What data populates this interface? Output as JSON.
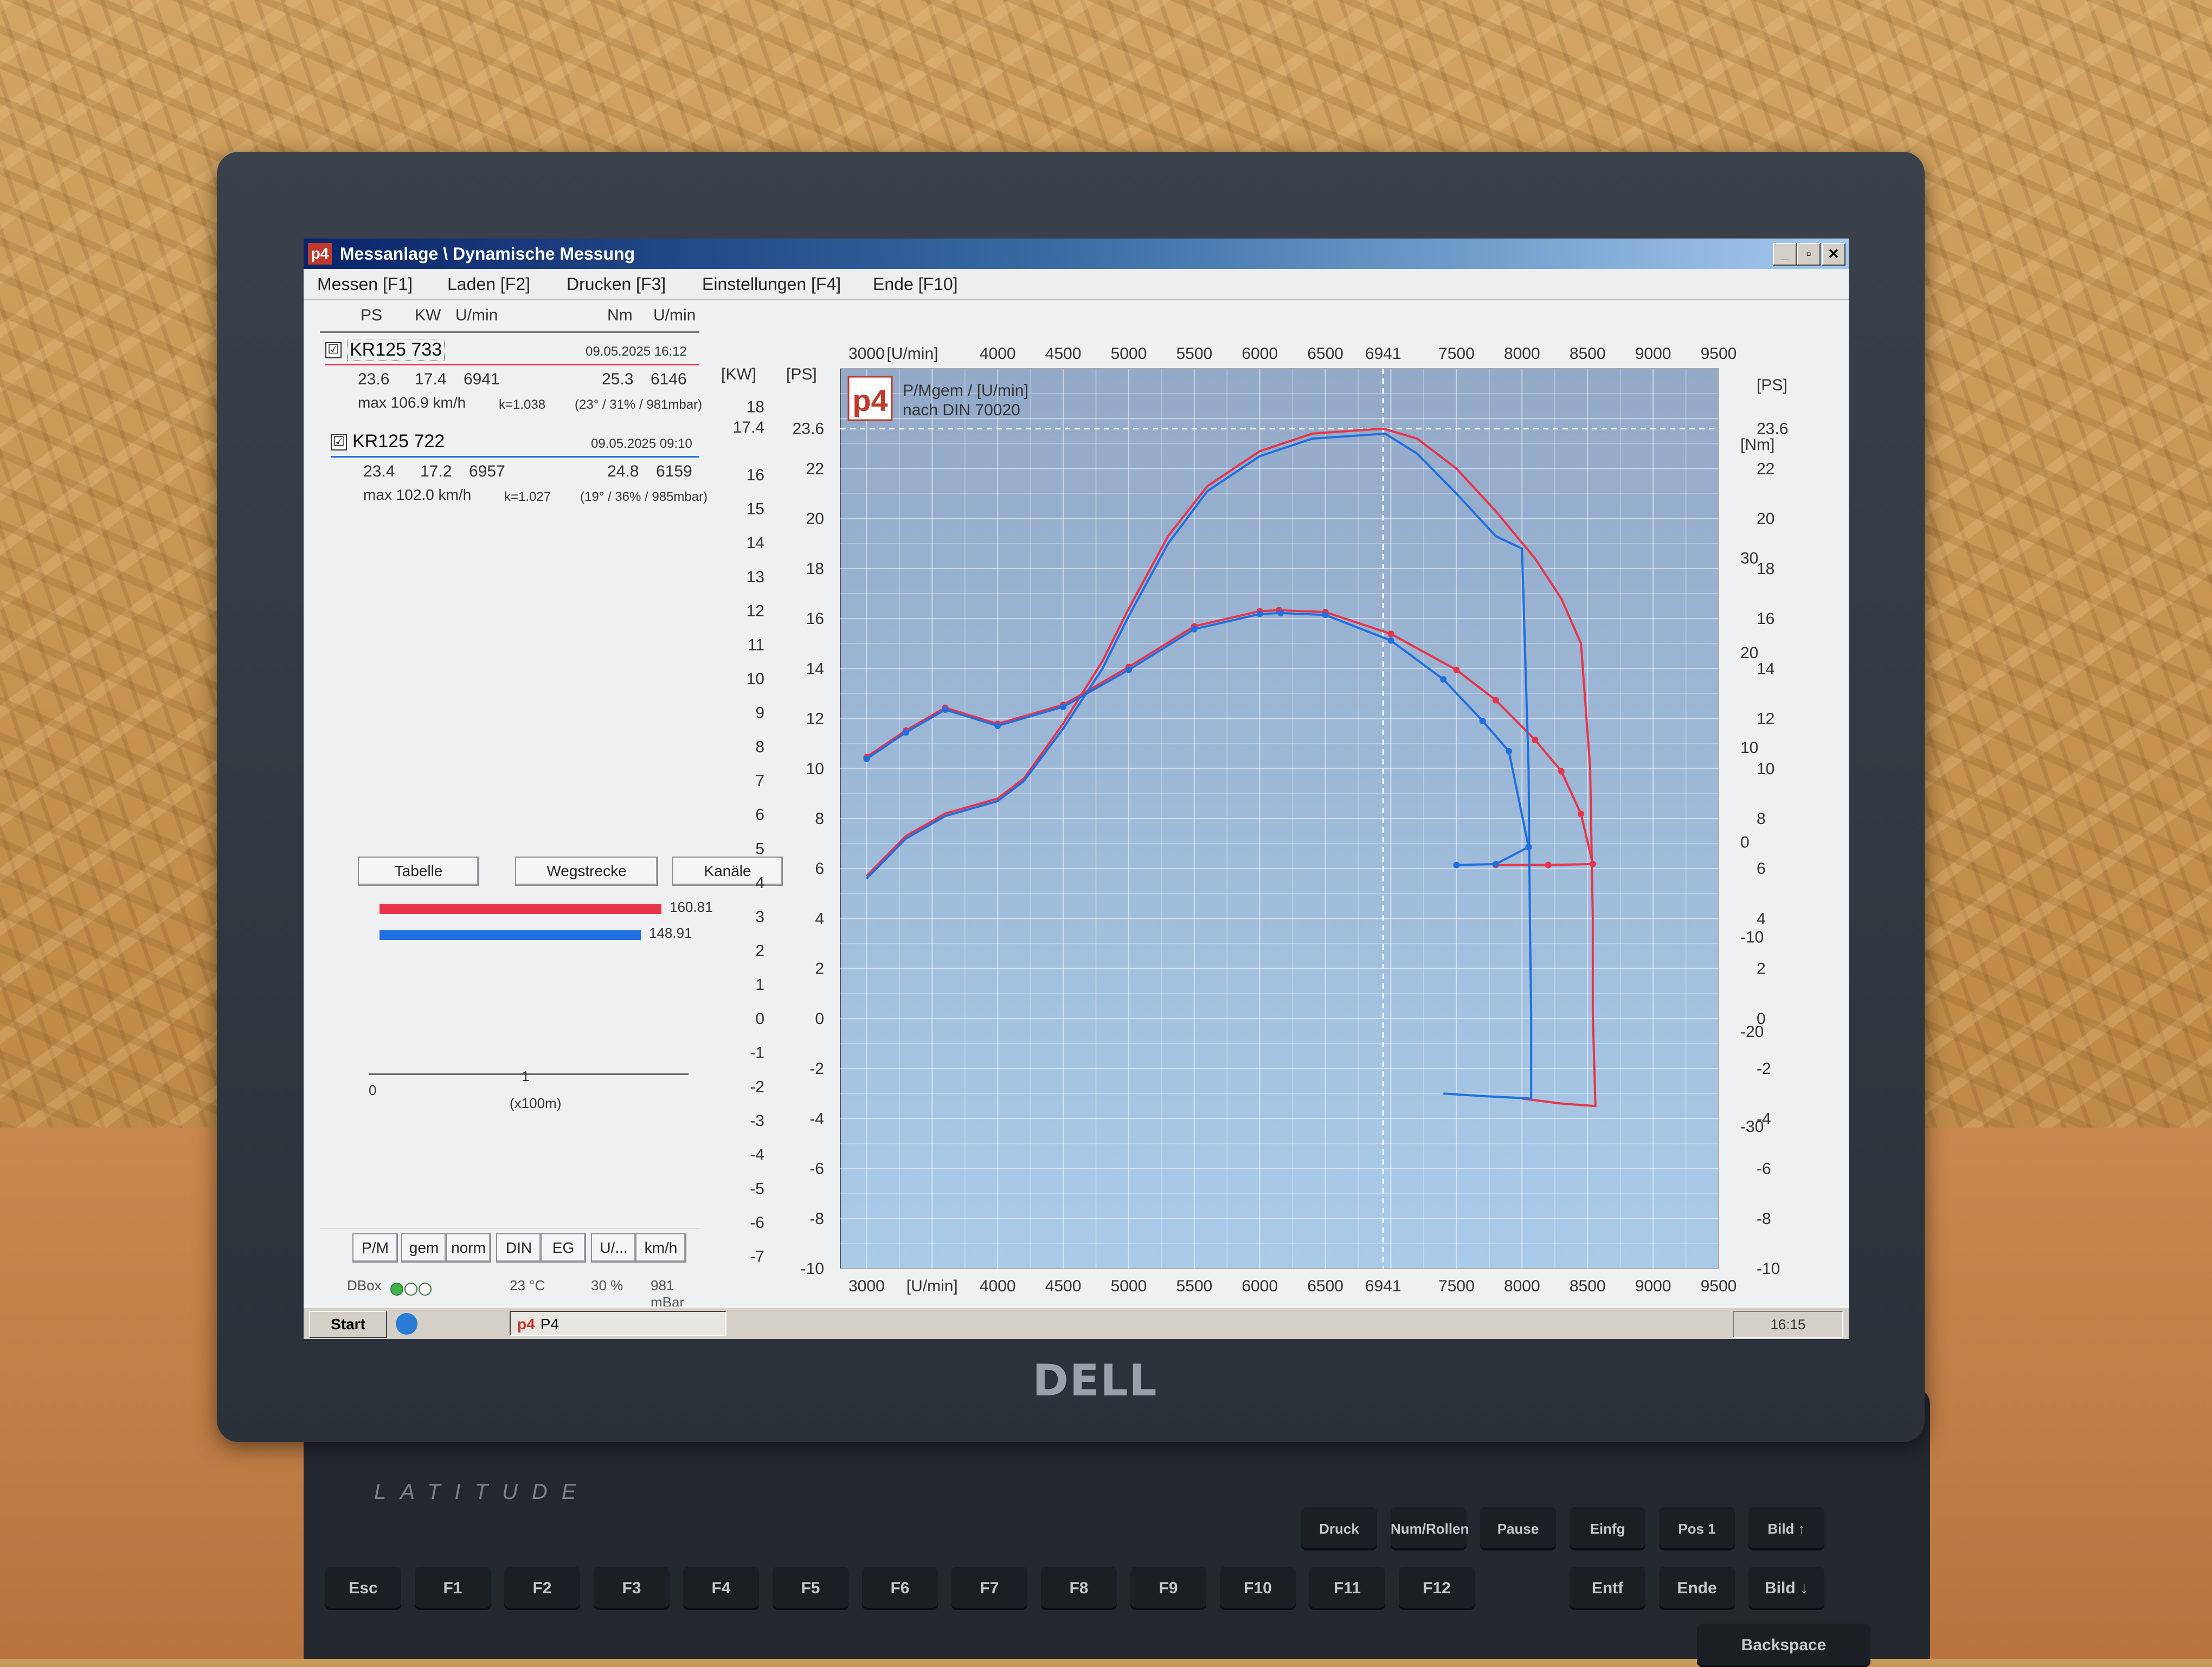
{
  "window": {
    "title": "Messanlage \\ Dynamische Messung",
    "app_icon": "p4"
  },
  "menu": [
    {
      "label": "Messen [F1]"
    },
    {
      "label": "Laden [F2]"
    },
    {
      "label": "Drucken [F3]"
    },
    {
      "label": "Einstellungen [F4]"
    },
    {
      "label": "Ende [F10]"
    }
  ],
  "panel": {
    "headers": {
      "ps": "PS",
      "kw": "KW",
      "rpm1": "U/min",
      "nm": "Nm",
      "rpm2": "U/min"
    },
    "entries": [
      {
        "checked": "☑",
        "name": "KR125 733",
        "date": "09.05.2025 16:12",
        "ps": "23.6",
        "kw": "17.4",
        "rpm": "6941",
        "nm": "25.3",
        "nm_rpm": "6146",
        "max": "max 106.9 km/h",
        "k": "k=1.038",
        "env": "(23° / 31% / 981mbar)",
        "color": "#e8344a"
      },
      {
        "checked": "☑",
        "name": "KR125 722",
        "date": "09.05.2025 09:10",
        "ps": "23.4",
        "kw": "17.2",
        "rpm": "6957",
        "nm": "24.8",
        "nm_rpm": "6159",
        "max": "max 102.0 km/h",
        "k": "k=1.027",
        "env": "(19° / 36% / 985mbar)",
        "color": "#1f6fe0"
      }
    ],
    "buttons_row1": [
      "P/M",
      "gem",
      "norm",
      "DIN",
      "EG",
      "U/...",
      "km/h"
    ],
    "buttons_row2": [
      "Tabelle",
      "Wegstrecke",
      "Kanäle"
    ],
    "bars": [
      {
        "value": "160.81",
        "color": "#e8344a"
      },
      {
        "value": "148.91",
        "color": "#1f6fe0"
      }
    ],
    "scale": {
      "zero": "0",
      "one": "1",
      "unit": "(x100m)"
    },
    "status": {
      "dbox": "DBox",
      "temp": "23 °C",
      "humidity": "30 %",
      "pressure": "981 mBar"
    }
  },
  "taskbar": {
    "start": "Start",
    "task": "P4",
    "clock": "16:15"
  },
  "laptop": {
    "brand": "DELL",
    "model": "LATITUDE",
    "keys": [
      "Esc",
      "F1",
      "F2",
      "F3",
      "F4",
      "F5",
      "F6",
      "F7",
      "F8",
      "F9",
      "F10",
      "F11",
      "F12",
      "Druck",
      "Num/Rollen",
      "Pause",
      "Einfg",
      "Pos 1",
      "Bild ↑",
      "Entf",
      "Ende",
      "Bild ↓",
      "Backspace"
    ]
  },
  "chart_data": {
    "type": "line",
    "title": "P/Mgem / [U/min]",
    "subtitle": "nach DIN 70020",
    "logo": "p4",
    "x_axis": {
      "label": "[U/min]",
      "ticks": [
        3000,
        4000,
        4500,
        5000,
        5500,
        6000,
        6500,
        6941,
        7500,
        8000,
        8500,
        9000,
        9500
      ],
      "range": [
        2800,
        9500
      ]
    },
    "y_axis_kw": {
      "label": "[KW]",
      "ticks": [
        -7,
        -6,
        -5,
        -4,
        -3,
        -2,
        -1,
        0,
        1,
        2,
        3,
        4,
        5,
        6,
        7,
        8,
        9,
        10,
        11,
        12,
        13,
        14,
        15,
        16,
        17.4,
        18
      ]
    },
    "y_axis_ps": {
      "label": "[PS]",
      "ticks": [
        -10,
        -8,
        -6,
        -4,
        -2,
        0,
        2,
        4,
        6,
        8,
        10,
        12,
        14,
        16,
        18,
        20,
        22,
        23.6
      ],
      "range": [
        -10,
        26
      ]
    },
    "y_axis_nm": {
      "label": "[Nm]",
      "ticks": [
        -30,
        -20,
        -10,
        0,
        10,
        20,
        30
      ],
      "range": [
        -45,
        50
      ]
    },
    "highlight": {
      "x": 6941,
      "y_ps": 23.6
    },
    "series": [
      {
        "name": "KR125 733",
        "color": "#e8344a",
        "power_ps": [
          [
            3000,
            5.7
          ],
          [
            3300,
            7.3
          ],
          [
            3600,
            8.2
          ],
          [
            4000,
            8.8
          ],
          [
            4200,
            9.6
          ],
          [
            4500,
            11.8
          ],
          [
            4800,
            14.3
          ],
          [
            5000,
            16.4
          ],
          [
            5300,
            19.3
          ],
          [
            5600,
            21.3
          ],
          [
            6000,
            22.7
          ],
          [
            6400,
            23.4
          ],
          [
            6941,
            23.6
          ],
          [
            7200,
            23.2
          ],
          [
            7500,
            22.0
          ],
          [
            7800,
            20.3
          ],
          [
            8100,
            18.4
          ],
          [
            8300,
            16.8
          ],
          [
            8450,
            15.0
          ],
          [
            8520,
            10.0
          ],
          [
            8540,
            4.0
          ],
          [
            8540,
            0.2
          ],
          [
            8560,
            -3.5
          ],
          [
            8300,
            -3.4
          ],
          [
            8000,
            -3.2
          ]
        ],
        "torque_nm": [
          [
            3000,
            9.0
          ],
          [
            3300,
            11.8
          ],
          [
            3600,
            14.2
          ],
          [
            4000,
            12.5
          ],
          [
            4500,
            14.5
          ],
          [
            5000,
            18.5
          ],
          [
            5500,
            22.8
          ],
          [
            6000,
            24.4
          ],
          [
            6146,
            24.5
          ],
          [
            6500,
            24.3
          ],
          [
            7000,
            22.0
          ],
          [
            7500,
            18.2
          ],
          [
            7800,
            15.0
          ],
          [
            8100,
            10.8
          ],
          [
            8300,
            7.5
          ],
          [
            8450,
            3.0
          ],
          [
            8540,
            -2.3
          ],
          [
            8200,
            -2.4
          ],
          [
            7800,
            -2.4
          ]
        ]
      },
      {
        "name": "KR125 722",
        "color": "#1f6fe0",
        "power_ps": [
          [
            3000,
            5.6
          ],
          [
            3300,
            7.2
          ],
          [
            3600,
            8.1
          ],
          [
            4000,
            8.7
          ],
          [
            4200,
            9.5
          ],
          [
            4500,
            11.6
          ],
          [
            4800,
            14.0
          ],
          [
            5000,
            16.1
          ],
          [
            5300,
            19.0
          ],
          [
            5600,
            21.1
          ],
          [
            6000,
            22.5
          ],
          [
            6400,
            23.2
          ],
          [
            6957,
            23.4
          ],
          [
            7200,
            22.6
          ],
          [
            7500,
            21.0
          ],
          [
            7800,
            19.3
          ],
          [
            8000,
            18.8
          ],
          [
            8050,
            10.0
          ],
          [
            8060,
            4.0
          ],
          [
            8070,
            0.2
          ],
          [
            8070,
            -3.2
          ],
          [
            7700,
            -3.1
          ],
          [
            7400,
            -3.0
          ]
        ],
        "torque_nm": [
          [
            3000,
            8.8
          ],
          [
            3300,
            11.6
          ],
          [
            3600,
            14.0
          ],
          [
            4000,
            12.3
          ],
          [
            4500,
            14.3
          ],
          [
            5000,
            18.2
          ],
          [
            5500,
            22.5
          ],
          [
            6000,
            24.1
          ],
          [
            6159,
            24.2
          ],
          [
            6500,
            24.0
          ],
          [
            7000,
            21.3
          ],
          [
            7400,
            17.2
          ],
          [
            7700,
            12.8
          ],
          [
            7900,
            9.6
          ],
          [
            8050,
            -0.5
          ],
          [
            7800,
            -2.3
          ],
          [
            7500,
            -2.4
          ]
        ]
      }
    ]
  }
}
